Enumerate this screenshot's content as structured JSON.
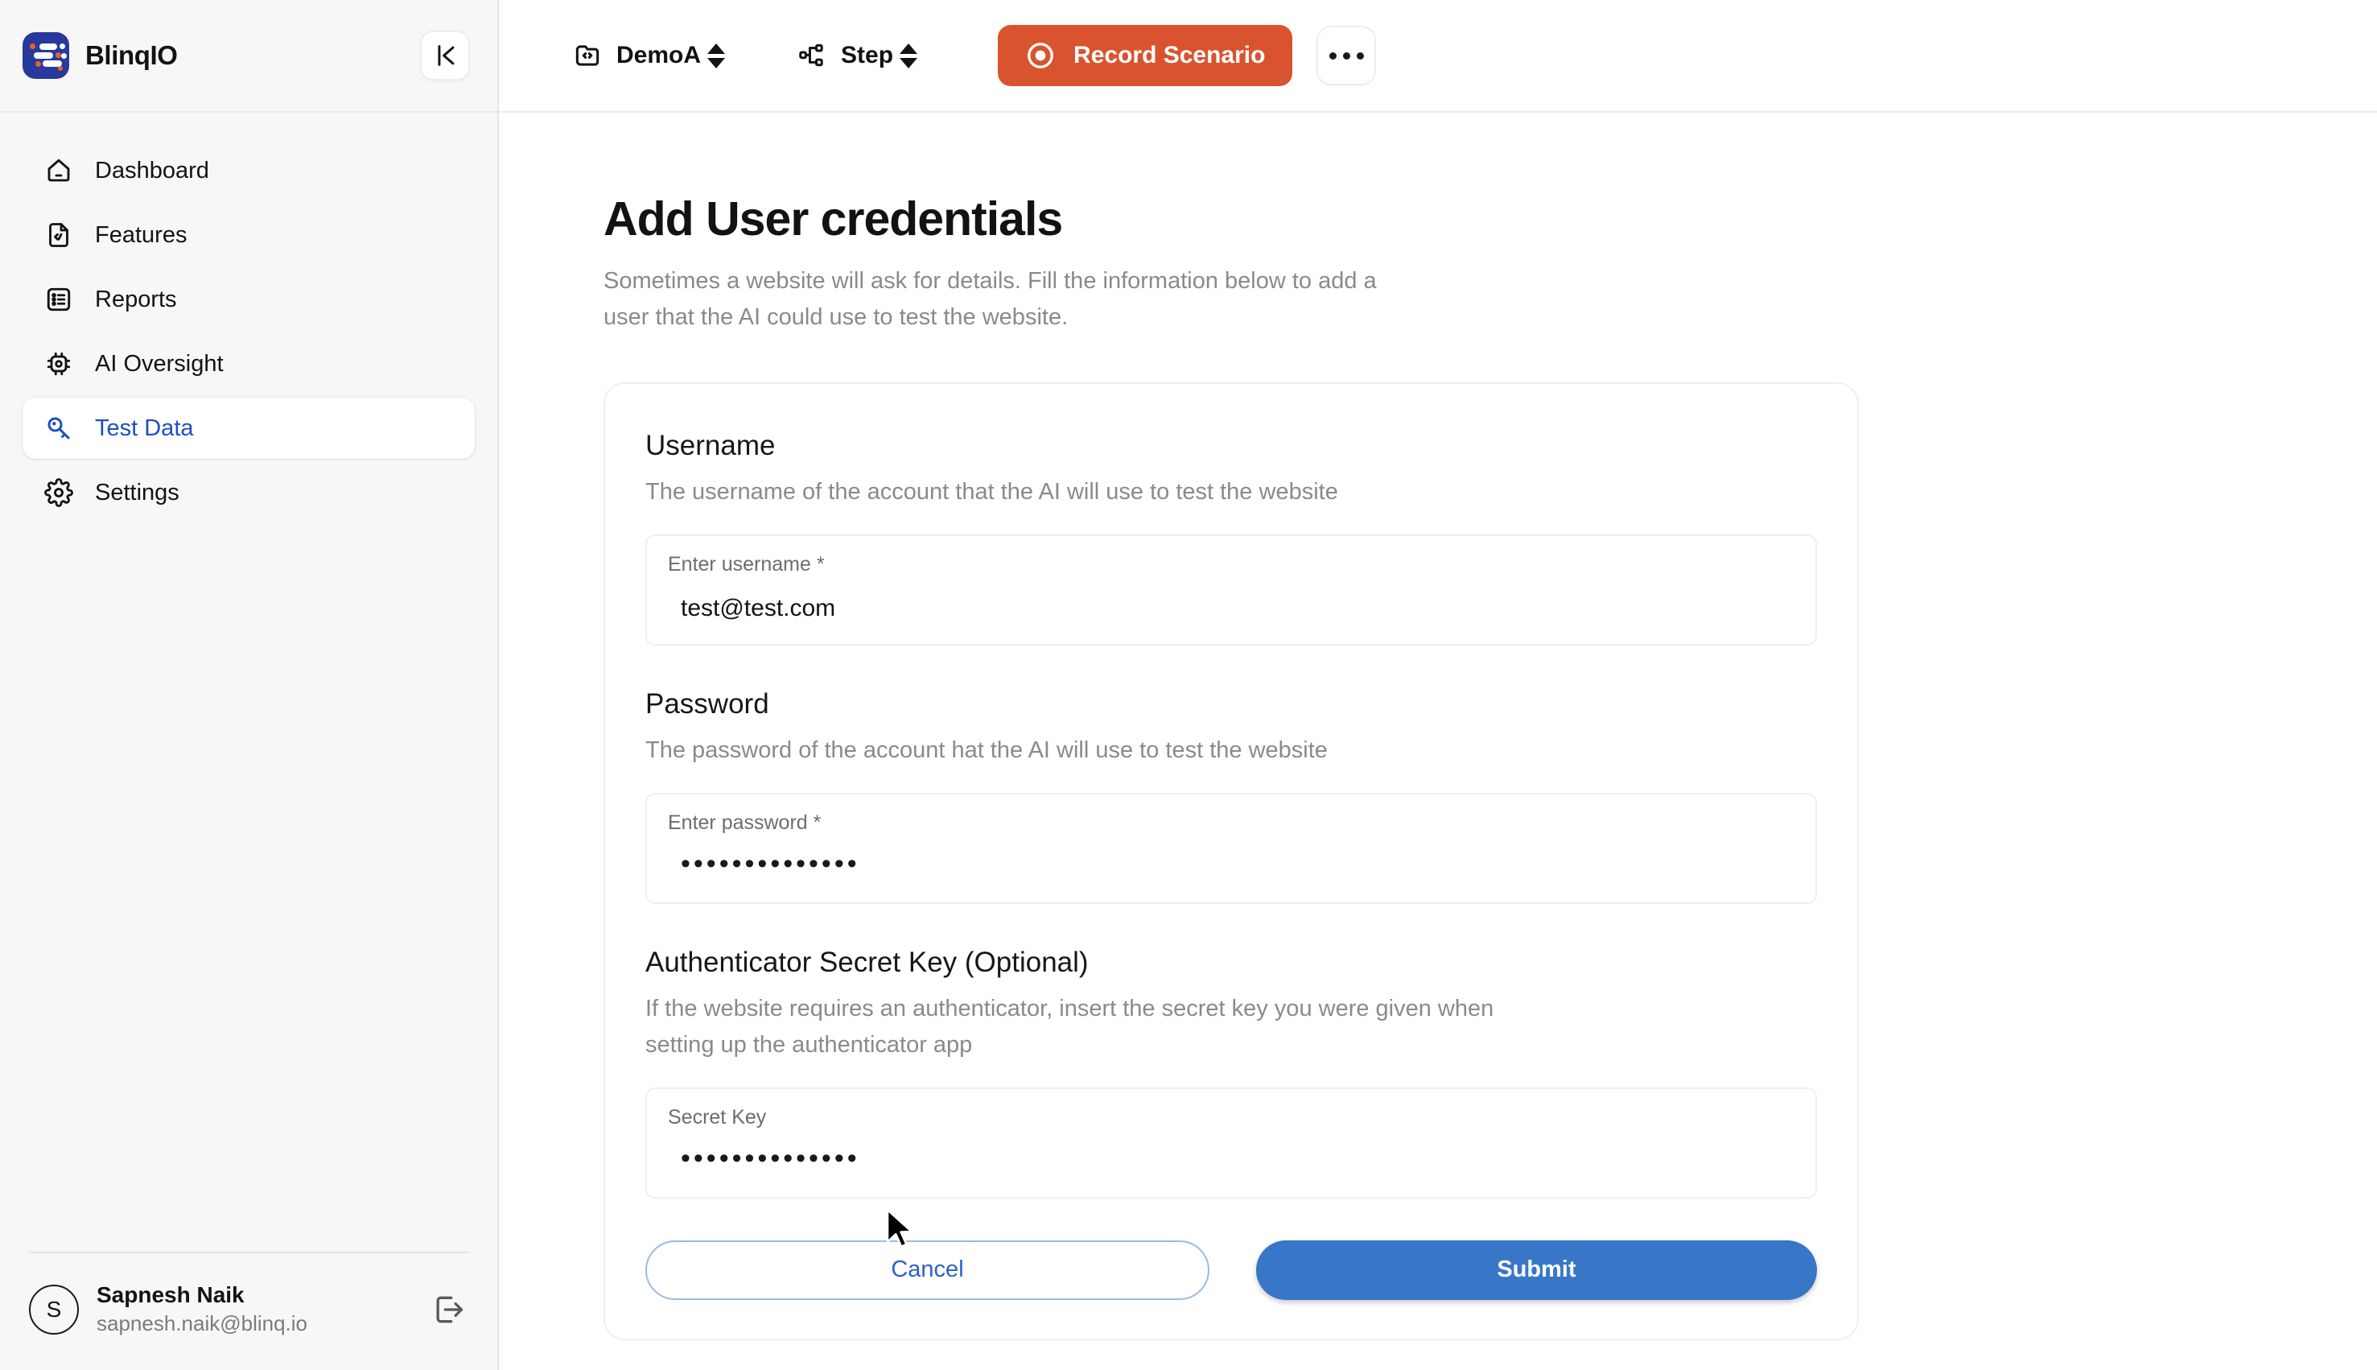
{
  "brand": {
    "name": "BlinqIO",
    "logo_icon": "blinqio-logo-icon"
  },
  "sidebar": {
    "collapse_icon": "collapse-panel-icon",
    "items": [
      {
        "label": "Dashboard",
        "icon": "home-icon",
        "active": false
      },
      {
        "label": "Features",
        "icon": "file-code-icon",
        "active": false
      },
      {
        "label": "Reports",
        "icon": "list-icon",
        "active": false
      },
      {
        "label": "AI Oversight",
        "icon": "cpu-icon",
        "active": false
      },
      {
        "label": "Test Data",
        "icon": "key-icon",
        "active": true
      },
      {
        "label": "Settings",
        "icon": "gear-icon",
        "active": false
      }
    ],
    "active_color": "#1e4fc0",
    "user": {
      "initial": "S",
      "name": "Sapnesh Naik",
      "email": "sapnesh.naik@blinq.io",
      "logout_icon": "logout-icon"
    }
  },
  "topbar": {
    "project": {
      "label": "DemoA",
      "icon": "project-folder-icon"
    },
    "step": {
      "label": "Step",
      "icon": "workflow-nodes-icon"
    },
    "record": {
      "label": "Record Scenario",
      "icon": "record-circle-icon",
      "color": "#d9542e"
    },
    "more": {
      "icon": "more-horizontal-icon"
    }
  },
  "page": {
    "title": "Add User credentials",
    "subtitle": "Sometimes a website will ask for details. Fill the information below to add a user that the AI could use to test the website."
  },
  "form": {
    "fields": [
      {
        "title": "Username",
        "description": "The username of the account that the AI will use to test the website",
        "input_label": "Enter username *",
        "value": "test@test.com",
        "masked": false
      },
      {
        "title": "Password",
        "description": "The password of the account hat the AI will use to test the website",
        "input_label": "Enter password *",
        "value": "••••••••••••••",
        "masked": true
      },
      {
        "title": "Authenticator Secret Key (Optional)",
        "description": "If the website requires an authenticator, insert the secret key you were given when setting up the authenticator app",
        "input_label": "Secret Key",
        "value": "••••••••••••••",
        "masked": true
      }
    ],
    "cancel_label": "Cancel",
    "submit_label": "Submit",
    "submit_color": "#3876c8",
    "cancel_color": "#2a63c7"
  }
}
